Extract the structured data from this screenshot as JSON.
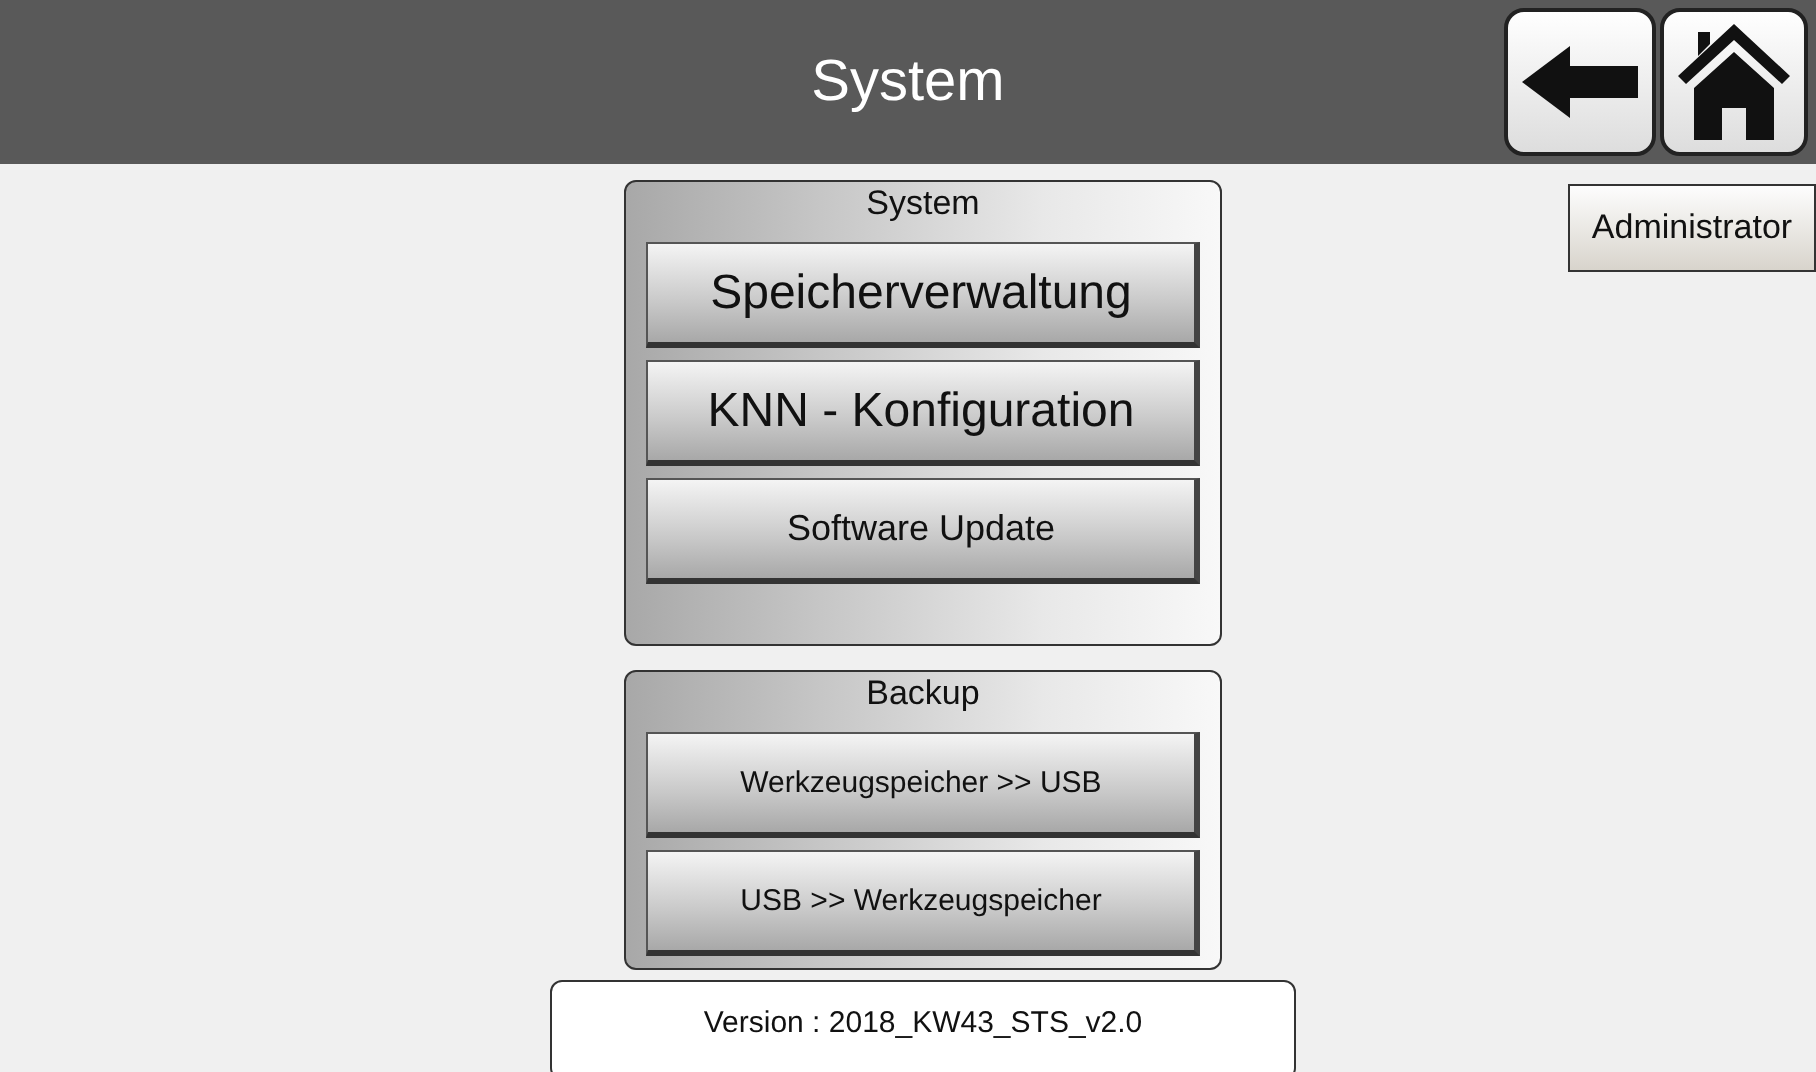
{
  "header": {
    "title": "System",
    "buttons": [
      {
        "kind": "back"
      },
      {
        "kind": "home"
      }
    ]
  },
  "user_button": {
    "label": "Administrator"
  },
  "panels": [
    {
      "title": "System",
      "buttons": [
        {
          "label": "Speicherverwaltung",
          "kind": "large"
        },
        {
          "label": "KNN - Konfiguration",
          "kind": "large"
        },
        {
          "label": "Software Update",
          "kind": "medium"
        }
      ]
    },
    {
      "title": "Backup",
      "buttons": [
        {
          "label": "Werkzeugspeicher >> USB",
          "kind": "small"
        },
        {
          "label": "USB >> Werkzeugspeicher",
          "kind": "small"
        }
      ]
    }
  ],
  "version": "Version : 2018_KW43_STS_v2.0"
}
